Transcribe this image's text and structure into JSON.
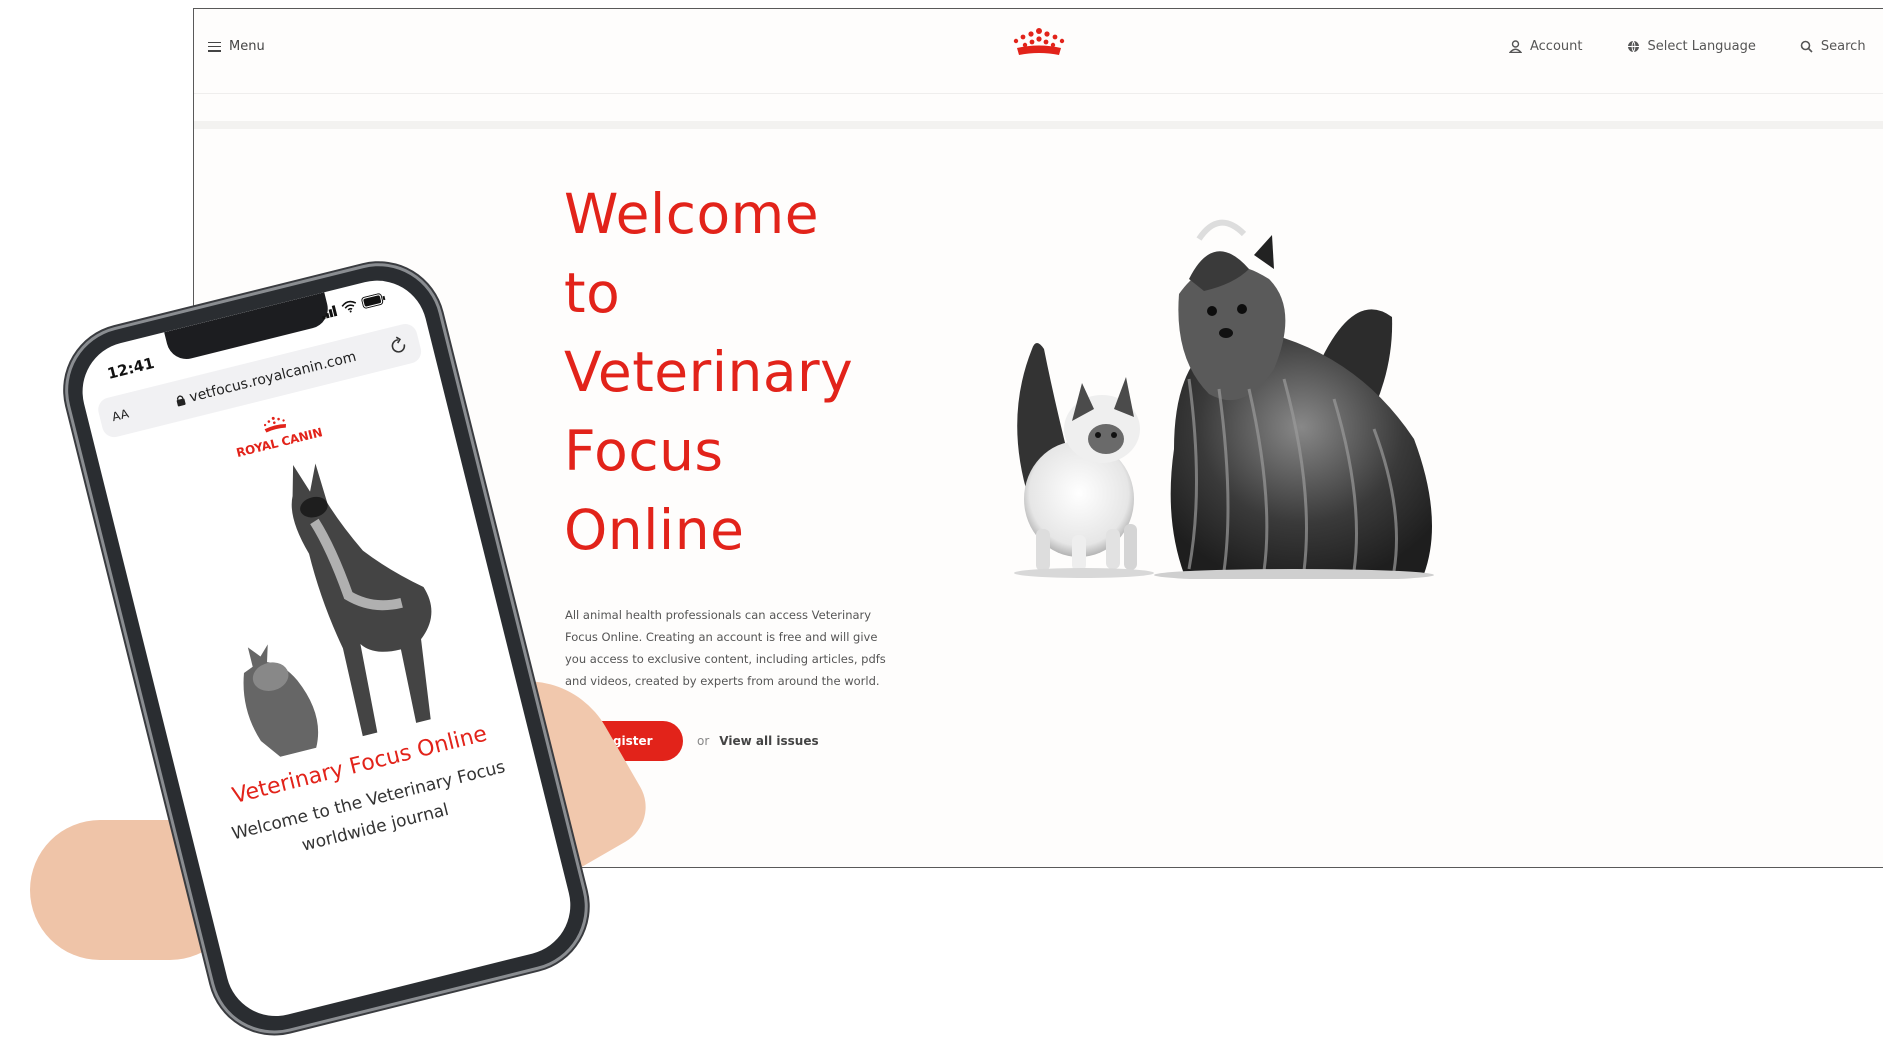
{
  "desktop": {
    "nav": {
      "menu_label": "Menu",
      "account_label": "Account",
      "language_label": "Select Language",
      "search_label": "Search"
    },
    "hero": {
      "title_lines": [
        "Welcome",
        "to",
        "Veterinary",
        "Focus",
        "Online"
      ],
      "description": "All animal health professionals can access Veterinary Focus Online. Creating an account is free and will give you access to exclusive content, including articles, pdfs and videos, created by experts from around the world.",
      "register_label": "Register",
      "or_text": "or",
      "view_all_label": "View all issues"
    }
  },
  "phone": {
    "status_time": "12:41",
    "text_size_label": "AA",
    "url": "vetfocus.royalcanin.com",
    "logo_text": "ROYAL CANIN",
    "title": "Veterinary Focus Online",
    "body_lines": [
      "Welcome to the Veterinary Focus",
      "worldwide journal"
    ]
  },
  "colors": {
    "brand_red": "#e2231a",
    "background": "#fefdfc",
    "text_gray": "#555555"
  },
  "icons": [
    "menu-icon",
    "crown-logo-icon",
    "account-icon",
    "globe-icon",
    "search-icon",
    "lock-icon",
    "reload-icon",
    "signal-icon",
    "wifi-icon",
    "battery-icon"
  ]
}
